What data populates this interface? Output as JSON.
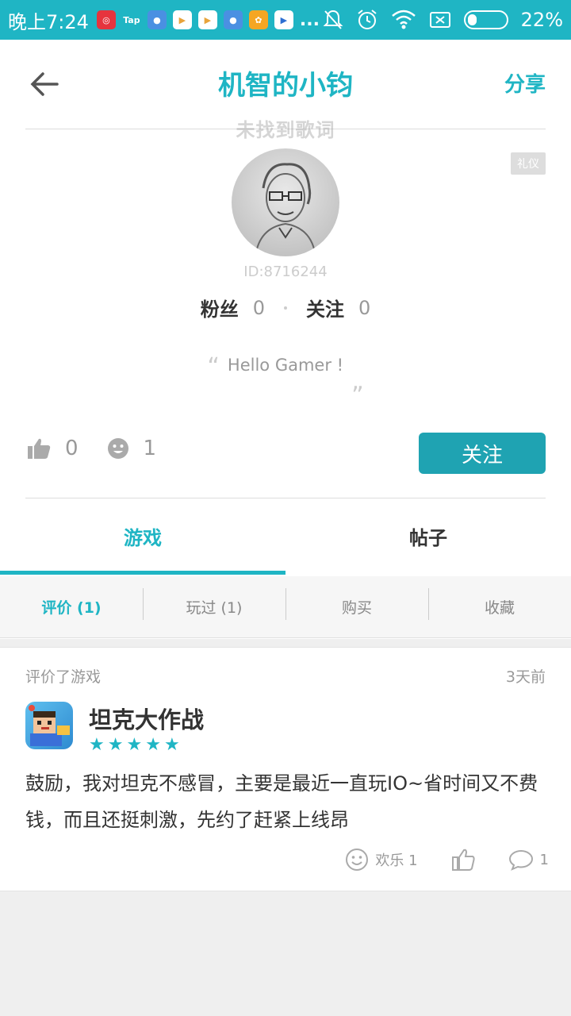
{
  "status_bar": {
    "time": "晚上7:24",
    "tap_label": "Tap",
    "more": "...",
    "battery": "22%",
    "battery_level": 0.22
  },
  "header": {
    "title": "机智的小钧",
    "share": "分享"
  },
  "profile": {
    "lyric": "未找到歌词",
    "badge": "礼仪",
    "user_id": "ID:8716244",
    "fans_label": "粉丝",
    "fans_count": "0",
    "following_label": "关注",
    "following_count": "0",
    "bio": "Hello Gamer !",
    "quote_open": "“",
    "quote_close": "„",
    "likes": "0",
    "smiles": "1",
    "follow_button": "关注"
  },
  "tabs": [
    {
      "label": "游戏",
      "active": true
    },
    {
      "label": "帖子",
      "active": false
    }
  ],
  "subtabs": [
    {
      "label": "评价 (1)",
      "active": true
    },
    {
      "label": "玩过 (1)",
      "active": false
    },
    {
      "label": "购买",
      "active": false
    },
    {
      "label": "收藏",
      "active": false
    }
  ],
  "review_card": {
    "action": "评价了游戏",
    "time": "3天前",
    "game_name": "坦克大作战",
    "rating": 5,
    "text": "鼓励，我对坦克不感冒，主要是最近一直玩IO~省时间又不费钱，而且还挺刺激，先约了赶紧上线昂",
    "fun_label": "欢乐 1",
    "comment_count": "1"
  },
  "colors": {
    "accent": "#1fb5c4",
    "button": "#1fa3b2",
    "background": "#efefef"
  }
}
